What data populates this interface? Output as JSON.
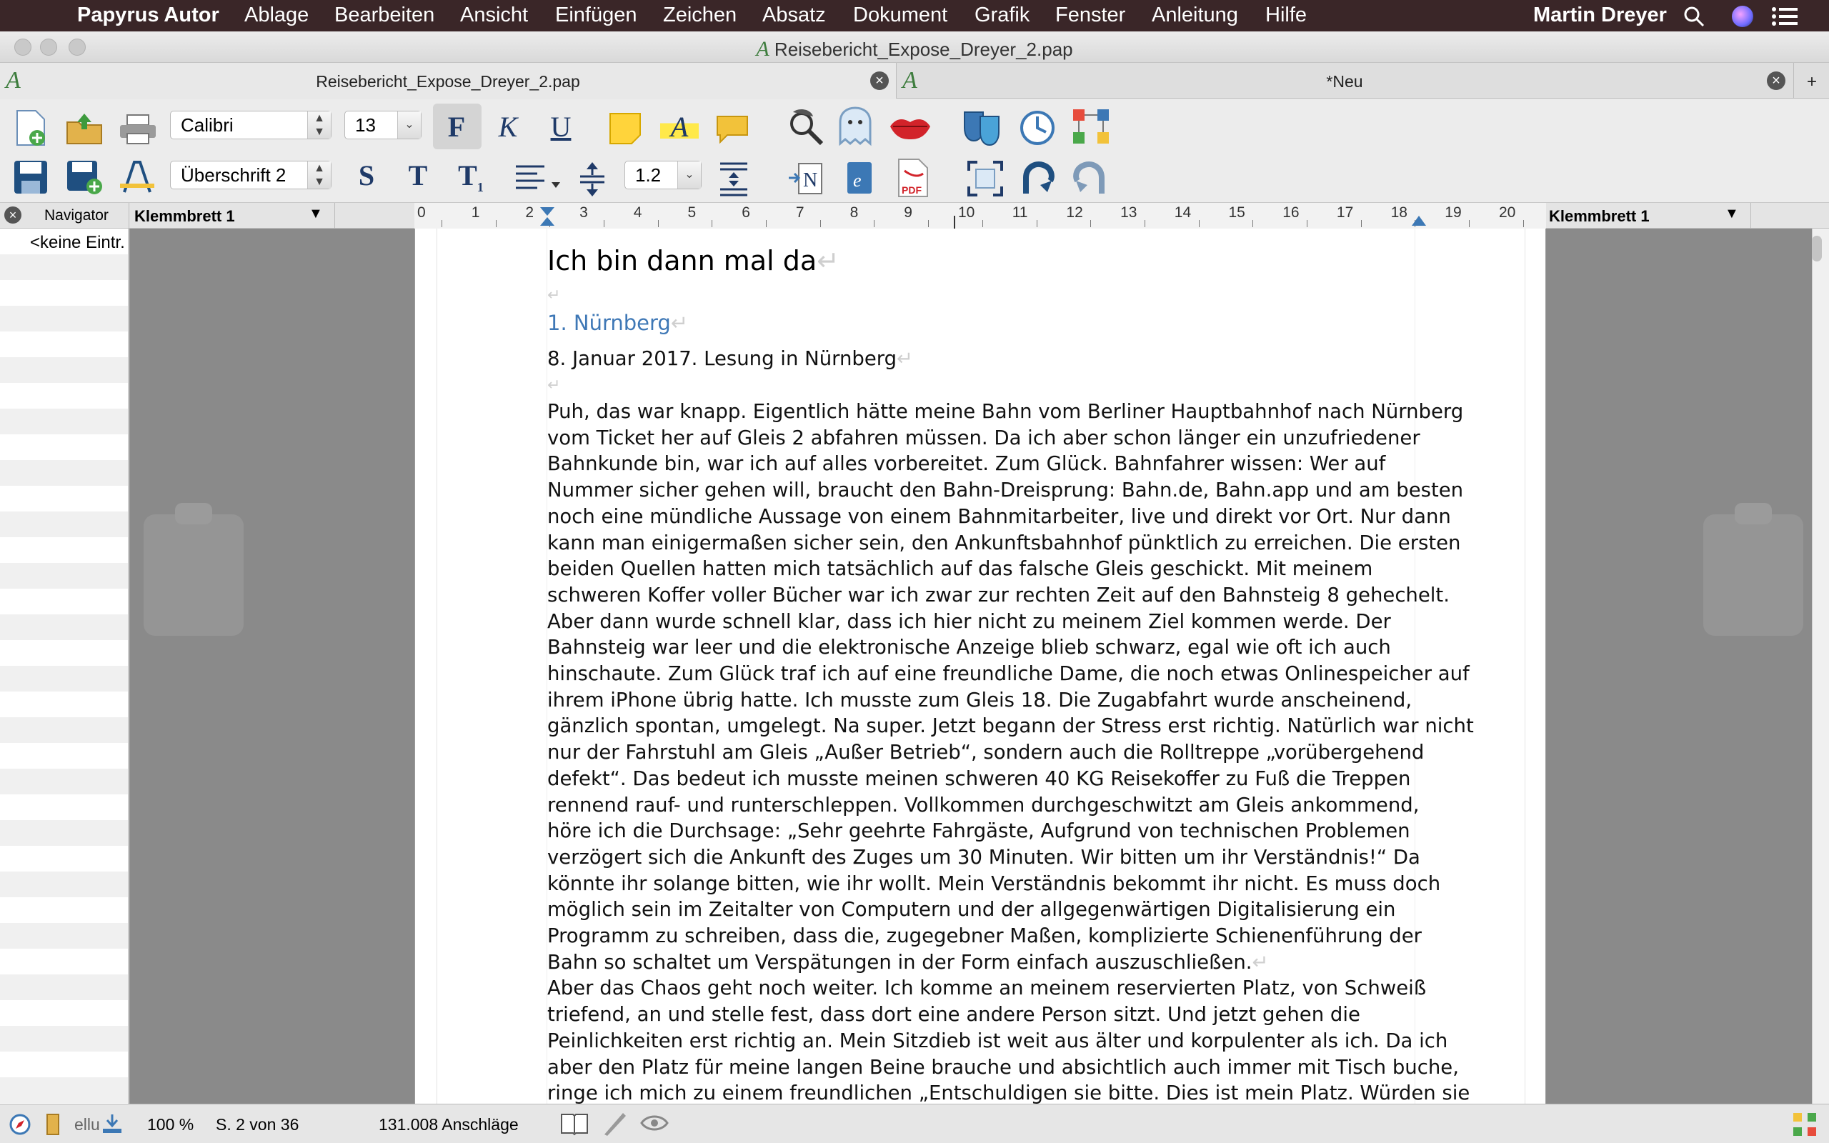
{
  "menubar": {
    "app_name": "Papyrus Autor",
    "items": [
      "Ablage",
      "Bearbeiten",
      "Ansicht",
      "Einfügen",
      "Zeichen",
      "Absatz",
      "Dokument",
      "Grafik",
      "Fenster",
      "Anleitung",
      "Hilfe"
    ],
    "user": "Martin Dreyer"
  },
  "window": {
    "title": "Reisebericht_Expose_Dreyer_2.pap"
  },
  "tabs": [
    {
      "label": "Reisebericht_Expose_Dreyer_2.pap"
    },
    {
      "label": "*Neu"
    }
  ],
  "tab_add": "+",
  "toolbar": {
    "font_name": "Calibri",
    "font_size": "13",
    "paragraph_style": "Überschrift 2",
    "line_spacing": "1.2",
    "bold_label": "F",
    "italic_label": "K",
    "underline_label": "U",
    "s_label": "S",
    "t_label": "T",
    "t1_label": "T",
    "t1_sub": "1"
  },
  "panels": {
    "navigator_label": "Navigator",
    "navigator_empty": "<keine Eintr.",
    "clipboard_left": "Klemmbrett 1",
    "clipboard_right": "Klemmbrett 1"
  },
  "ruler": {
    "ticks": [
      "0",
      "1",
      "2",
      "3",
      "4",
      "5",
      "6",
      "7",
      "8",
      "9",
      "10",
      "11",
      "12",
      "13",
      "14",
      "15",
      "16",
      "17",
      "18",
      "19",
      "20"
    ]
  },
  "document": {
    "heading1": "Ich bin dann mal da",
    "heading2": "1. Nürnberg",
    "dateline": "8. Januar 2017. Lesung in Nürnberg",
    "body_lines": [
      "Puh, das war knapp. Eigentlich hätte meine Bahn vom Berliner Hauptbahnhof nach Nürnberg",
      "vom Ticket her auf Gleis 2 abfahren müssen. Da ich aber schon länger ein unzufriedener",
      "Bahnkunde bin, war ich auf alles vorbereitet. Zum Glück. Bahnfahrer wissen: Wer auf",
      "Nummer sicher gehen will, braucht den Bahn-Dreisprung: Bahn.de, Bahn.app und am besten",
      "noch eine mündliche Aussage von einem Bahnmitarbeiter, live und direkt vor Ort. Nur dann",
      "kann man einigermaßen sicher sein, den Ankunftsbahnhof pünktlich zu erreichen. Die ersten",
      "beiden Quellen hatten mich tatsächlich auf das falsche Gleis geschickt. Mit meinem",
      "schweren Koffer voller Bücher war ich zwar zur rechten Zeit auf den Bahnsteig 8 gehechelt.",
      "Aber dann wurde schnell klar, dass ich hier nicht zu meinem Ziel kommen werde. Der",
      "Bahnsteig war leer und die elektronische Anzeige blieb schwarz, egal wie oft ich auch",
      "hinschaute. Zum Glück traf ich auf eine freundliche Dame, die noch etwas Onlinespeicher auf",
      "ihrem iPhone übrig hatte. Ich musste zum Gleis 18. Die Zugabfahrt wurde anscheinend,",
      "gänzlich spontan, umgelegt. Na super. Jetzt begann der Stress erst richtig. Natürlich war nicht",
      "nur der Fahrstuhl am Gleis „Außer Betrieb“, sondern auch die Rolltreppe „vorübergehend",
      "defekt“. Das bedeut ich musste meinen schweren 40 KG Reisekoffer zu Fuß die Treppen",
      "rennend rauf- und runterschleppen. Vollkommen durchgeschwitzt am Gleis ankommend,",
      "höre ich die Durchsage: „Sehr geehrte Fahrgäste, Aufgrund von technischen Problemen",
      "verzögert sich die Ankunft des Zuges um 30 Minuten. Wir bitten um ihr Verständnis!“ Da",
      "könnte ihr solange bitten, wie ihr wollt. Mein Verständnis bekommt ihr nicht. Es muss doch",
      "möglich sein im Zeitalter von Computern und der allgegenwärtigen Digitalisierung ein",
      "Programm zu schreiben, dass die, zugegebner Maßen, komplizierte Schienenführung der",
      "Bahn so schaltet um Verspätungen in der Form einfach auszuschließen."
    ],
    "body2_lines": [
      "Aber das Chaos geht noch weiter. Ich komme an meinem reservierten Platz, von Schweiß",
      "triefend, an und stelle fest, dass dort eine andere Person sitzt. Und jetzt gehen die",
      "Peinlichkeiten erst richtig an. Mein Sitzdieb ist weit aus älter und korpulenter als ich. Da ich",
      "aber den Platz für meine langen Beine brauche und absichtlich auch immer mit Tisch buche,",
      "ringe ich mich zu einem freundlichen „Entschuldigen sie bitte. Dies ist mein Platz. Würden sie"
    ],
    "paragraph_mark": "↵"
  },
  "status": {
    "style_fragment": "ellu",
    "zoom": "100 %",
    "page": "S. 2 von 36",
    "chars": "131.008 Anschläge"
  }
}
